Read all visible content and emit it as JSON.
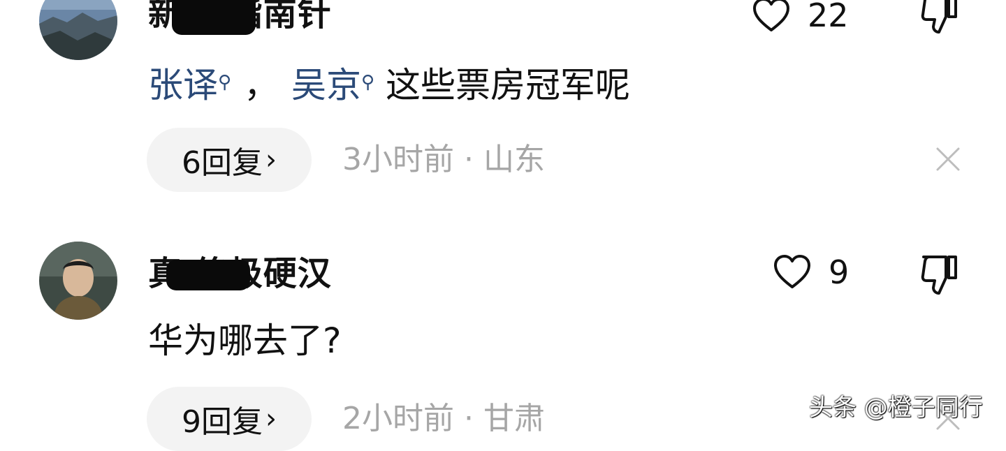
{
  "comments": [
    {
      "author": "新    代指南针",
      "likes": "22",
      "content_segments": [
        {
          "type": "mention",
          "text": "张译"
        },
        {
          "type": "text",
          "text": "，"
        },
        {
          "type": "mention",
          "text": "吴京"
        },
        {
          "type": "text",
          "text": "这些票房冠军呢"
        }
      ],
      "replies_label": "6回复",
      "meta": "3小时前 · 山东"
    },
    {
      "author": "真    终极硬汉",
      "likes": "9",
      "content_segments": [
        {
          "type": "text",
          "text": "华为哪去了?"
        }
      ],
      "replies_label": "9回复",
      "meta": "2小时前 · 甘肃"
    }
  ],
  "watermark": "头条 @橙子同行",
  "icons": {
    "like": "heart-outline-icon",
    "dislike": "thumb-down-icon",
    "close": "close-icon",
    "reply_chevron": "chevron-right-icon",
    "mention_marker": "search-icon"
  },
  "colors": {
    "mention": "#2b4a78",
    "meta": "#a6a6a6",
    "pill_bg": "#f3f3f3"
  }
}
